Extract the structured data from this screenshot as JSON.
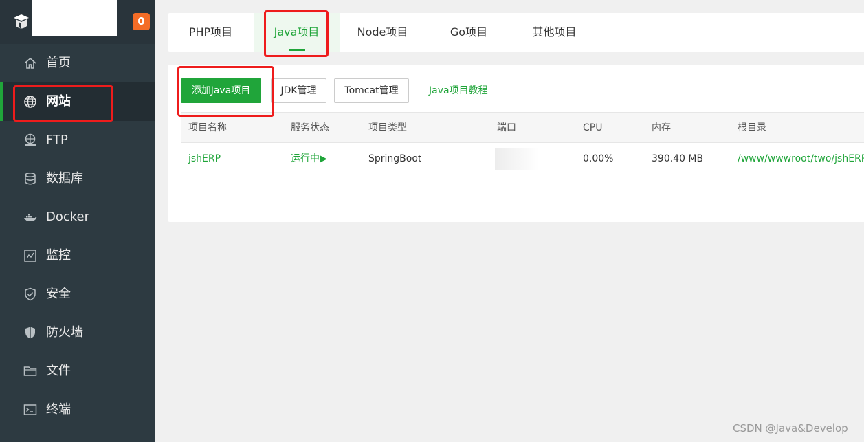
{
  "sidebar": {
    "badge": "0",
    "items": [
      {
        "label": "首页",
        "icon": "home-icon"
      },
      {
        "label": "网站",
        "icon": "globe-icon",
        "active": true
      },
      {
        "label": "FTP",
        "icon": "ftp-icon"
      },
      {
        "label": "数据库",
        "icon": "database-icon"
      },
      {
        "label": "Docker",
        "icon": "docker-icon"
      },
      {
        "label": "监控",
        "icon": "monitor-icon"
      },
      {
        "label": "安全",
        "icon": "shield-icon"
      },
      {
        "label": "防火墙",
        "icon": "firewall-icon"
      },
      {
        "label": "文件",
        "icon": "folder-icon"
      },
      {
        "label": "终端",
        "icon": "terminal-icon"
      }
    ]
  },
  "tabs": [
    {
      "label": "PHP项目"
    },
    {
      "label": "Java项目",
      "active": true
    },
    {
      "label": "Node项目"
    },
    {
      "label": "Go项目"
    },
    {
      "label": "其他项目"
    }
  ],
  "toolbar": {
    "add_label": "添加Java项目",
    "jdk_label": "JDK管理",
    "tomcat_label": "Tomcat管理",
    "tutorial_label": "Java项目教程"
  },
  "table": {
    "columns": [
      "项目名称",
      "服务状态",
      "项目类型",
      "端口",
      "CPU",
      "内存",
      "根目录"
    ],
    "rows": [
      {
        "name": "jshERP",
        "status": "运行中▶",
        "type": "SpringBoot",
        "cpu": "0.00%",
        "memory": "390.40 MB",
        "root": "/www/wwwroot/two/jshERP"
      }
    ]
  },
  "colors": {
    "accent": "#20a53a",
    "sidebar_bg": "#2d3a41",
    "badge": "#f46c26",
    "highlight": "#ee1c1c"
  },
  "watermark": "CSDN @Java&Develop"
}
